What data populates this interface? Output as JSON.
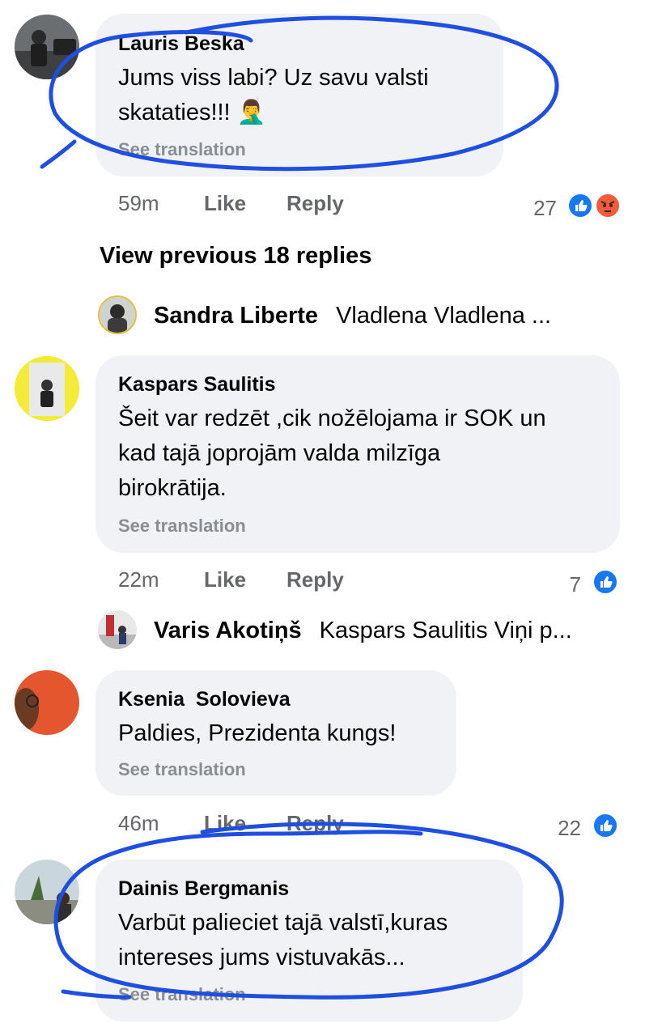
{
  "colors": {
    "bubble_bg": "#f0f2f5",
    "meta_text": "#65676b",
    "see_translation": "#8a8d91",
    "like_blue": "#1877f2",
    "angry_orange": "#f25c3a",
    "scribble_blue": "#1e4fe0"
  },
  "comments": [
    {
      "author": "Lauris Beska",
      "lines": [
        "Jums viss labi? Uz savu valsti",
        "skataties!!! 🤦‍♂️"
      ],
      "see_translation": "See translation",
      "time": "59m",
      "like_label": "Like",
      "reply_label": "Reply",
      "reaction_count": "27",
      "reactions": [
        "like-icon",
        "angry-icon"
      ]
    },
    {
      "author": "Kaspars Saulitis",
      "lines": [
        "Šeit var redzēt ,cik nožēlojama ir SOK un",
        "kad tajā joprojām valda milzīga",
        "birokrātija."
      ],
      "see_translation": "See translation",
      "time": "22m",
      "like_label": "Like",
      "reply_label": "Reply",
      "reaction_count": "7",
      "reactions": [
        "like-icon"
      ]
    },
    {
      "author": "Ksenia  Solovieva",
      "lines": [
        "Paldies, Prezidenta kungs!"
      ],
      "see_translation": "See translation",
      "time": "46m",
      "like_label": "Like",
      "reply_label": "Reply",
      "reaction_count": "22",
      "reactions": [
        "like-icon"
      ]
    },
    {
      "author": "Dainis Bergmanis",
      "lines": [
        "Varbūt palieciet tajā valstī,kuras",
        "intereses jums vistuvakās..."
      ],
      "see_translation": "See translation"
    }
  ],
  "view_previous": "View previous 18 replies",
  "replies": [
    {
      "name": "Sandra Liberte",
      "text": "Vladlena Vladlena  ..."
    },
    {
      "name": "Varis Akotiņš",
      "text": "Kaspars Saulitis Viņi p..."
    }
  ]
}
